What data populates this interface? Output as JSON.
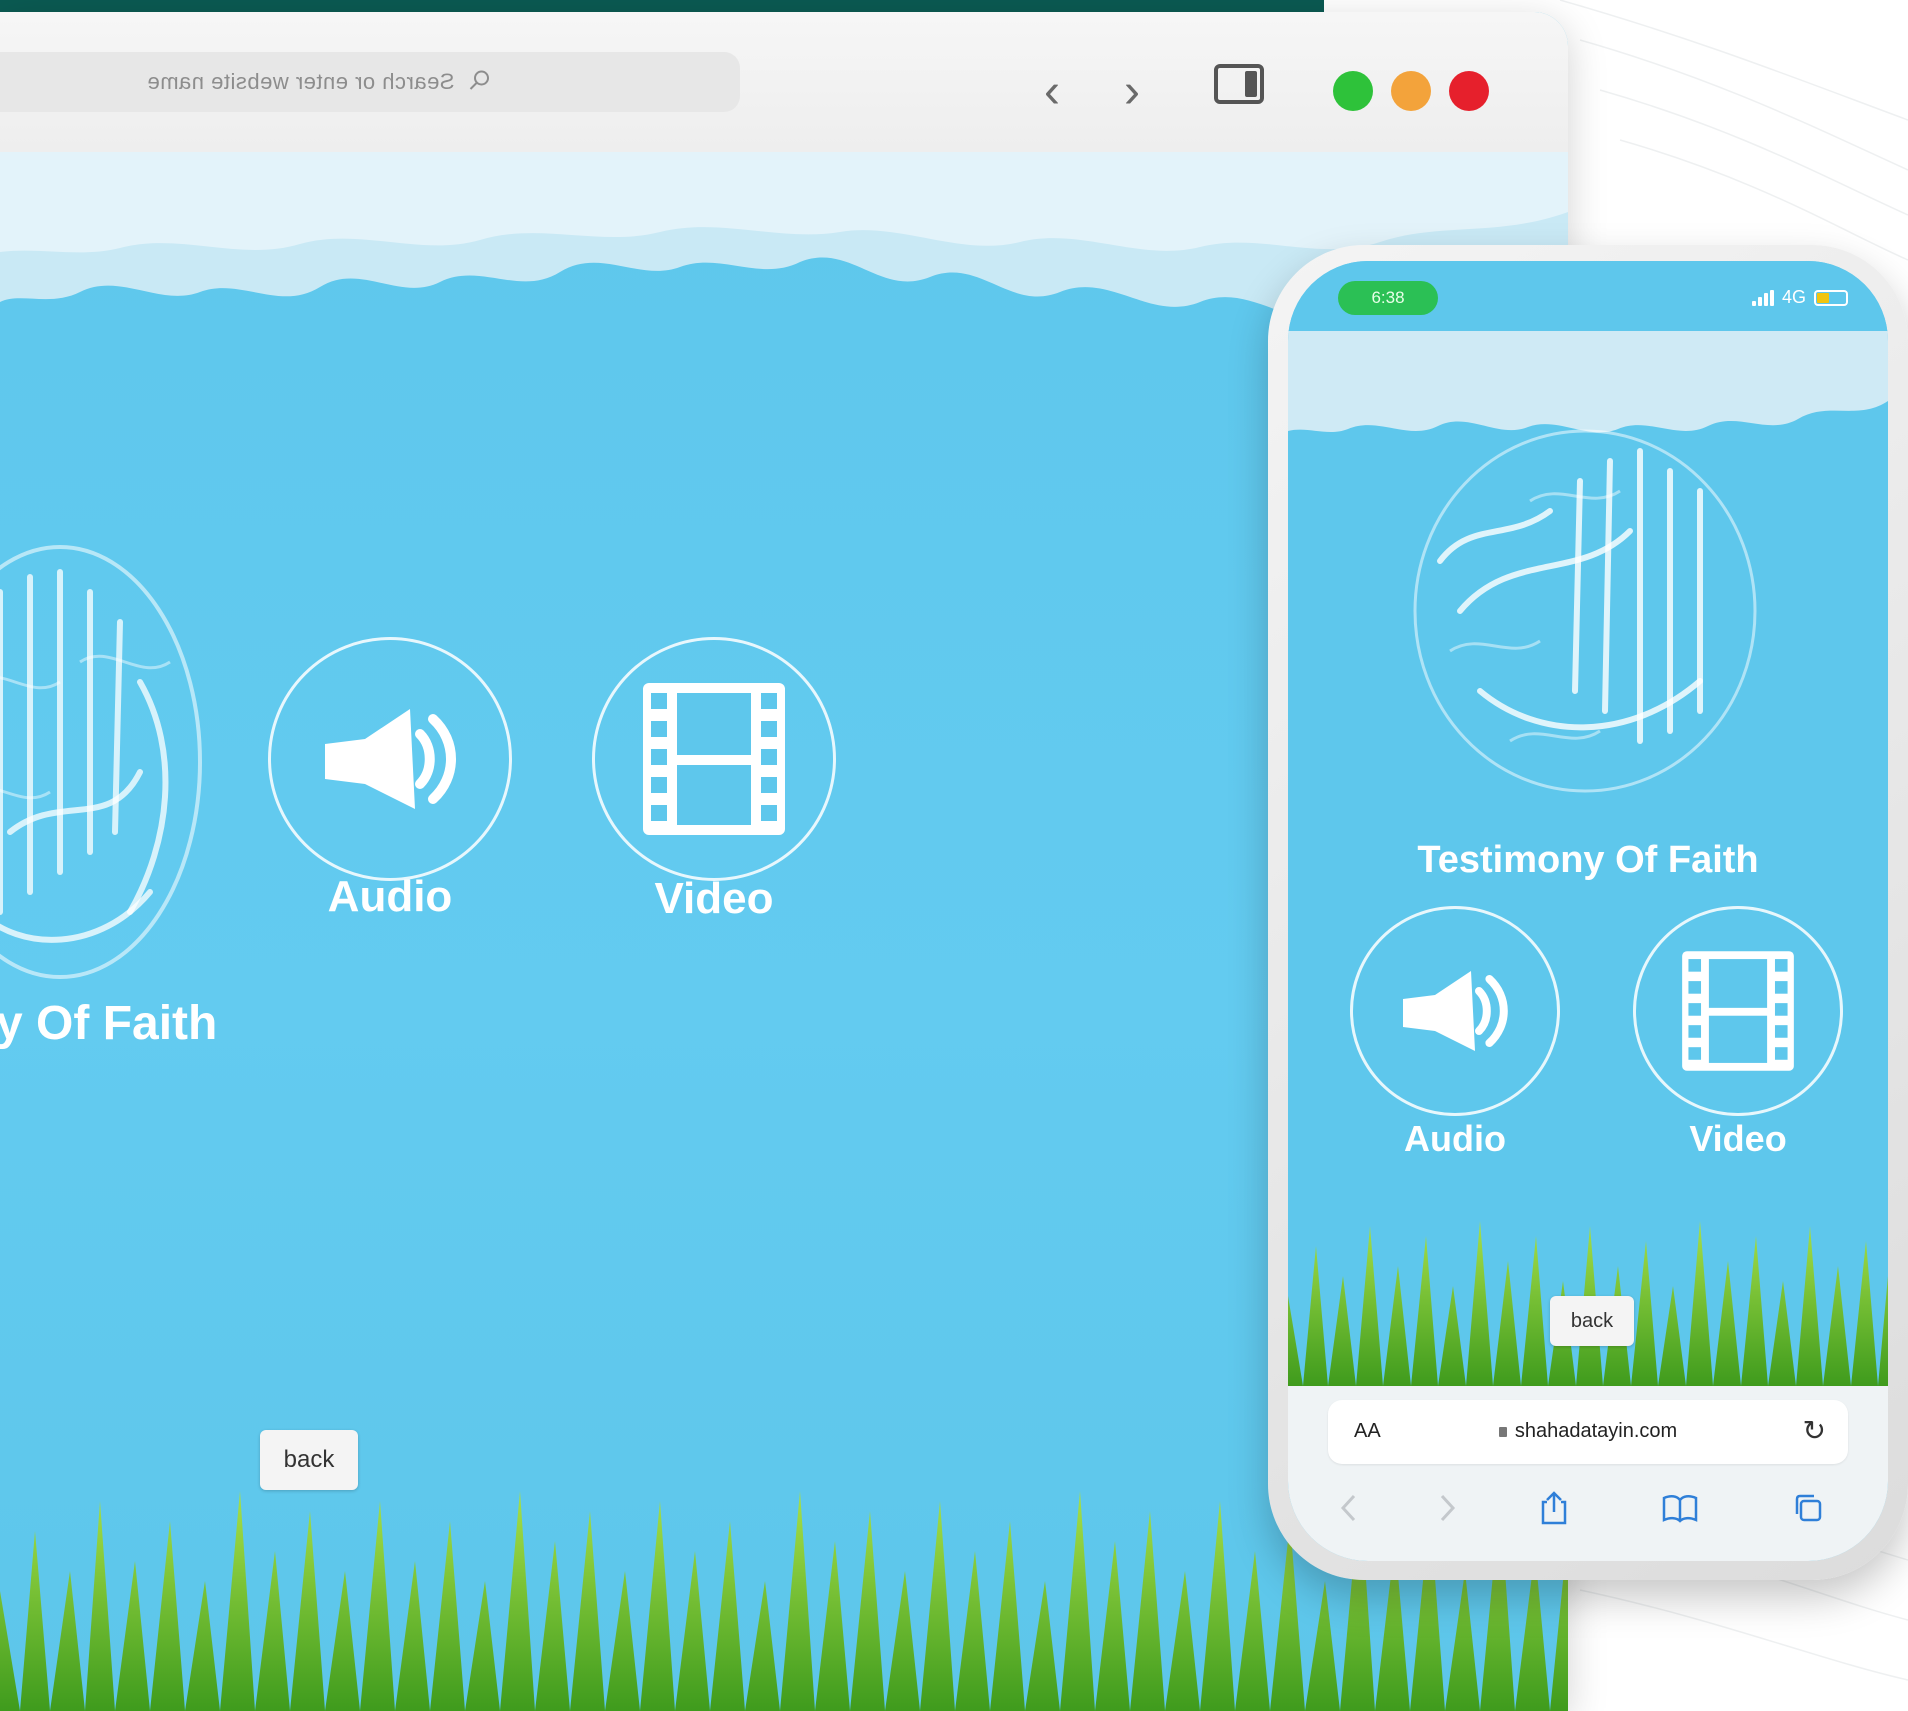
{
  "browser": {
    "search_placeholder": "Search or enter website name",
    "back_arrow": "‹",
    "forward_arrow": "›"
  },
  "desktop_page": {
    "headline": "y Of Faith",
    "audio_label": "Audio",
    "video_label": "Video",
    "back_label": "back"
  },
  "phone": {
    "time": "6:38",
    "network": "4G",
    "headline": "Testimony Of Faith",
    "audio_label": "Audio",
    "video_label": "Video",
    "back_label": "back",
    "url_aa": "AA",
    "url": "shahadatayin.com"
  },
  "colors": {
    "sky": "#5ec7ec",
    "traffic_green": "#2ec23a",
    "traffic_orange": "#f3a33b",
    "traffic_red": "#e6202c",
    "status_green": "#2bc055"
  },
  "icons": [
    "search-icon",
    "speaker-icon",
    "film-icon",
    "share-icon",
    "bookmarks-icon",
    "tabs-icon",
    "reload-icon",
    "lock-icon",
    "sidebar-icon"
  ]
}
